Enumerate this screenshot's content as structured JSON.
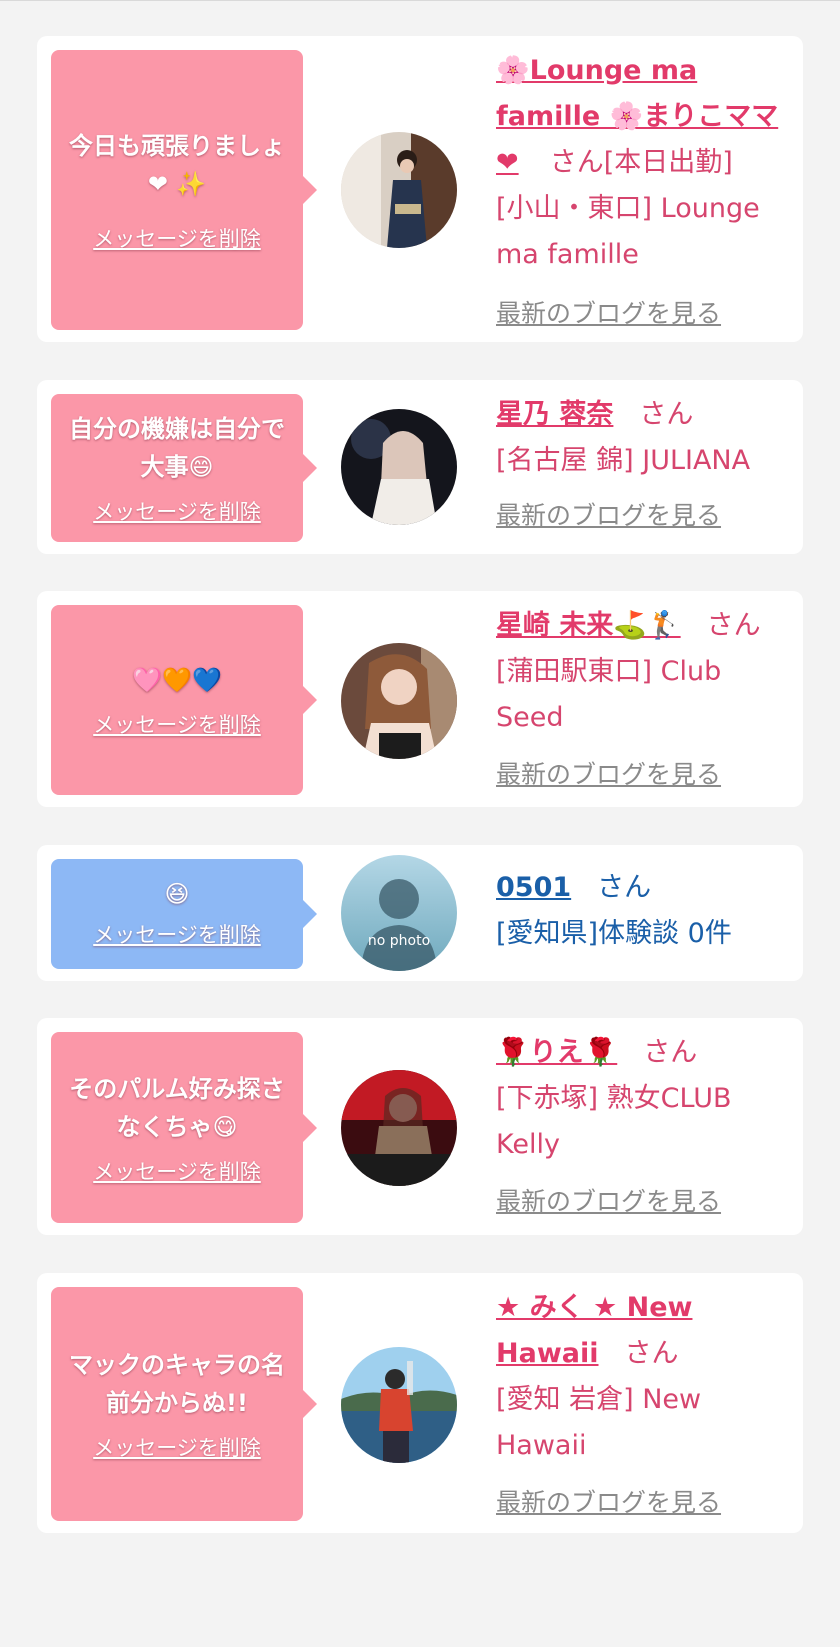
{
  "entries": [
    {
      "message": "今日も頑張りましょ",
      "message_emoji": "❤ ✨",
      "delete_label": "メッセージを削除",
      "name_prefix_icon": "cherry-blossom-icon",
      "name": "🌸Lounge ma famille 🌸まりこママ❤",
      "san": "さん",
      "status": "[本日出勤]",
      "shop": "[小山・東口] Lounge ma famille",
      "blog_label": "最新のブログを見る"
    },
    {
      "message": "自分の機嫌は自分で大事",
      "message_emoji": "😄",
      "delete_label": "メッセージを削除",
      "name": "星乃 蓉奈",
      "san": "さん",
      "shop": "[名古屋 錦] JULIANA",
      "blog_label": "最新のブログを見る"
    },
    {
      "message": "",
      "message_emoji": "🩷🧡💙",
      "delete_label": "メッセージを削除",
      "name": "星崎 未来⛳🏌",
      "san": "さん",
      "shop": "[蒲田駅東口] Club Seed",
      "blog_label": "最新のブログを見る"
    },
    {
      "message": "",
      "message_emoji": "😆",
      "delete_label": "メッセージを削除",
      "name": "0501",
      "san": "さん",
      "shop": "[愛知県]体験談 0件",
      "avatar_text": "no photo"
    },
    {
      "message": "そのパルム好み探さなくちゃ",
      "message_emoji": "😋",
      "delete_label": "メッセージを削除",
      "name": "🌹りえ🌹",
      "san": "さん",
      "shop": "[下赤塚] 熟女CLUB Kelly",
      "blog_label": "最新のブログを見る"
    },
    {
      "message": "マックのキャラの名前分からぬ!!",
      "message_emoji": "",
      "delete_label": "メッセージを削除",
      "name": "★ みく ★ New Hawaii",
      "san": "さん",
      "shop": "[愛知 岩倉] New Hawaii",
      "blog_label": "最新のブログを見る"
    }
  ],
  "colors": {
    "pink_bubble": "#fb97a8",
    "blue_bubble": "#8db8f5",
    "pink_text": "#d6456e",
    "blue_text": "#1a5fa8",
    "blog_link": "#8a8a8a"
  }
}
